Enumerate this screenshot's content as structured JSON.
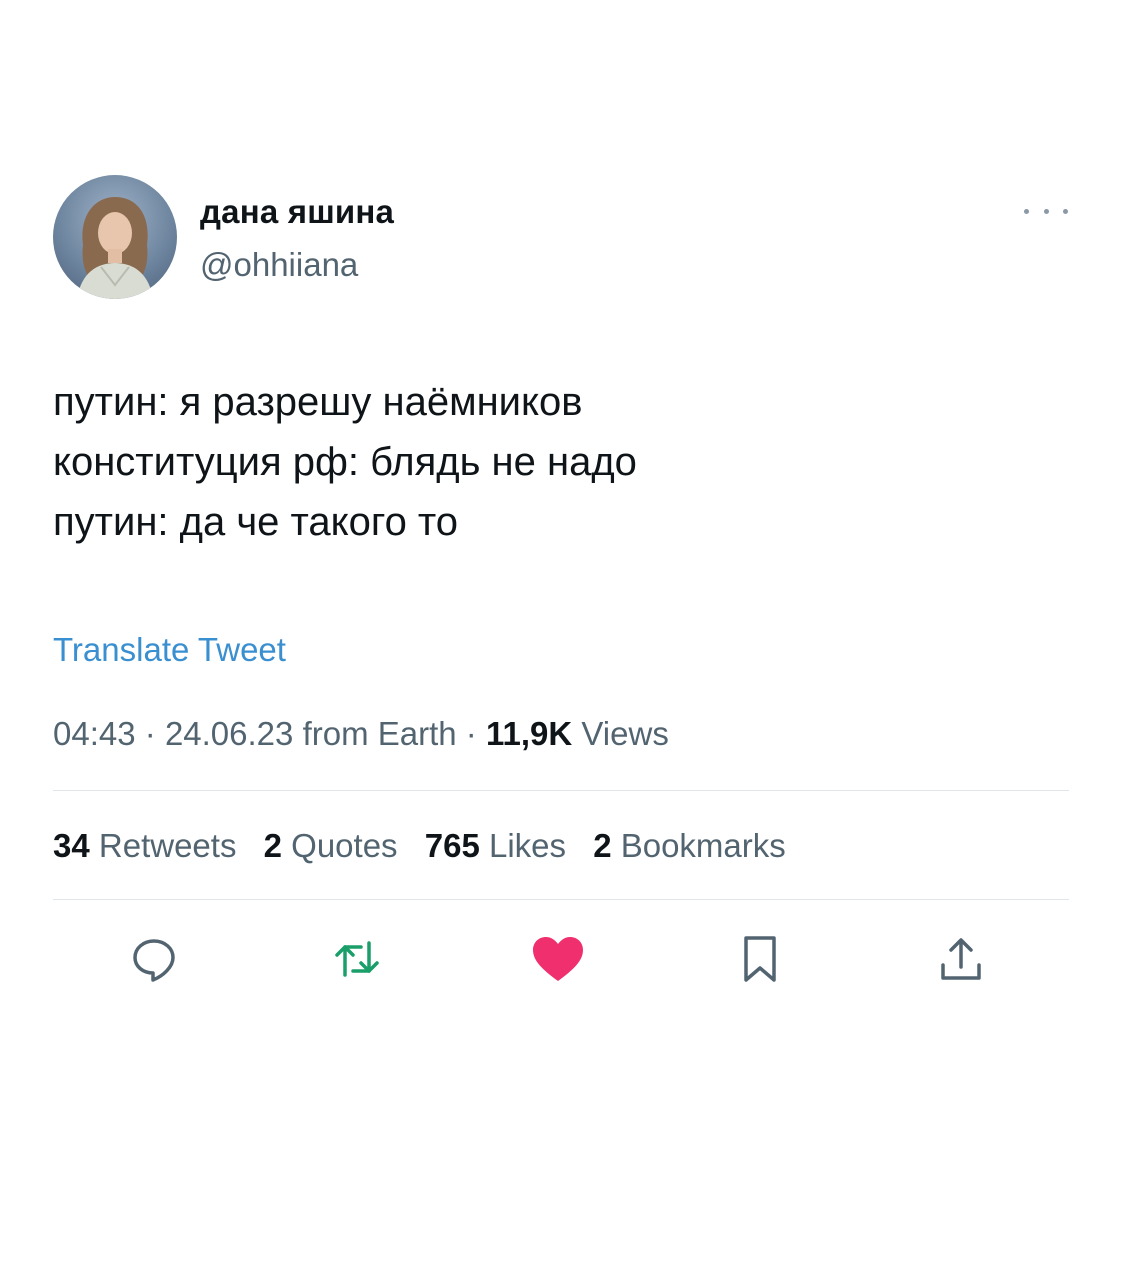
{
  "user": {
    "display_name": "дана яшина",
    "handle": "@ohhiiana"
  },
  "tweet": {
    "lines": [
      "путин: я разрешу наёмников",
      "конституция рф: блядь не надо",
      "путин: да че такого то"
    ],
    "translate_label": "Translate Tweet"
  },
  "meta": {
    "time": "04:43",
    "separator": "·",
    "date": "24.06.23",
    "source": "from Earth",
    "views_count": "11,9K",
    "views_label": "Views"
  },
  "stats": {
    "retweets_count": "34",
    "retweets_label": "Retweets",
    "quotes_count": "2",
    "quotes_label": "Quotes",
    "likes_count": "765",
    "likes_label": "Likes",
    "bookmarks_count": "2",
    "bookmarks_label": "Bookmarks"
  },
  "icons": {
    "more": "more-horizontal-icon",
    "reply": "reply-icon",
    "retweet": "retweet-icon",
    "like": "heart-icon",
    "bookmark": "bookmark-icon",
    "share": "share-icon"
  },
  "colors": {
    "text": "#0f1419",
    "secondary": "#536471",
    "link": "#3a8fd0",
    "retweet": "#1a9e6a",
    "like": "#f0306e",
    "icon": "#536471",
    "divider": "#e1e6ea"
  }
}
